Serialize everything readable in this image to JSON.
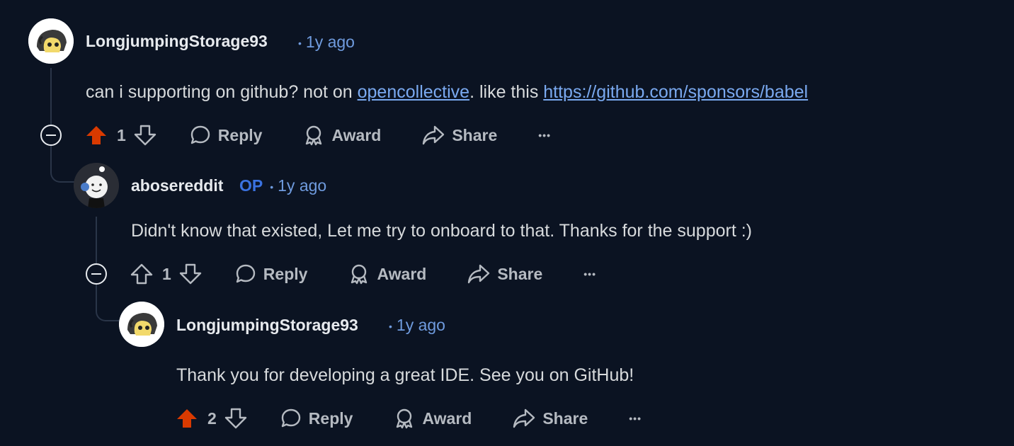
{
  "comments": [
    {
      "username": "LongjumpingStorage93",
      "age": "1y ago",
      "text_before": "can i supporting on github? not on ",
      "link1": "opencollective",
      "text_middle": ". like this ",
      "link2": "https://github.com/sponsors/babel",
      "votes": "1",
      "upvoted": true
    },
    {
      "username": "abosereddit",
      "op_badge": "OP",
      "age": "1y ago",
      "text": "Didn't know that existed, Let me try to onboard to that. Thanks for the support :)",
      "votes": "1",
      "upvoted": false
    },
    {
      "username": "LongjumpingStorage93",
      "age": "1y ago",
      "text": "Thank you for developing a great IDE. See you on GitHub!",
      "votes": "2",
      "upvoted": true
    }
  ],
  "actions": {
    "reply": "Reply",
    "award": "Award",
    "share": "Share",
    "more": "•••"
  },
  "meta_dot": "•",
  "colors": {
    "background": "#0b1322",
    "upvote_active": "#d93a00",
    "link": "#7aa9f0",
    "meta": "#6f9bde",
    "op": "#3a72e0"
  }
}
